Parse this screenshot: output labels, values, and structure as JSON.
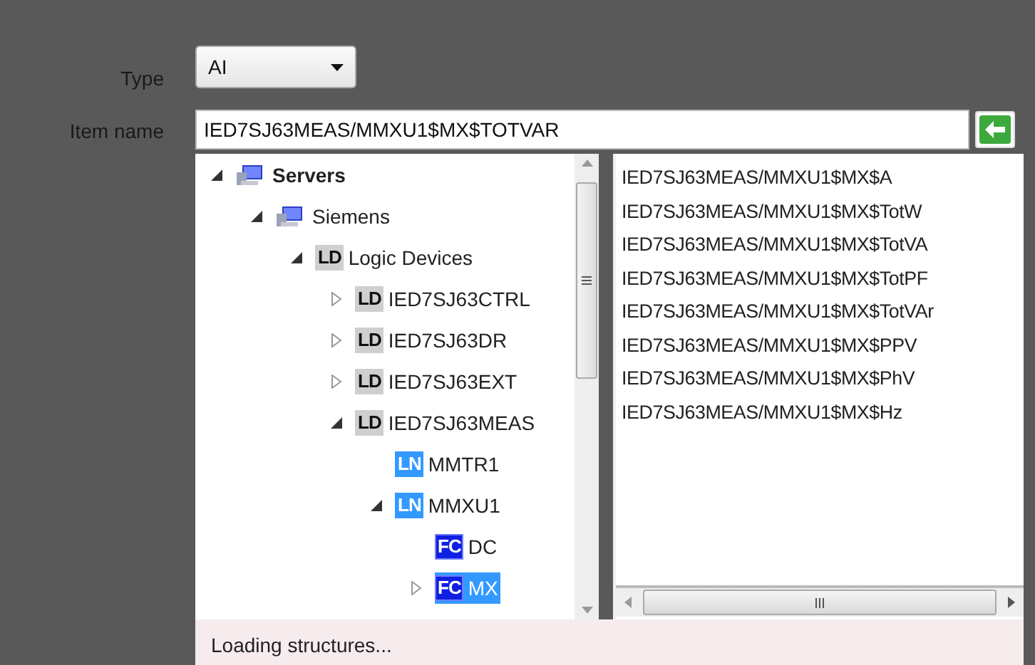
{
  "type_field": {
    "label": "Type",
    "value": "AI"
  },
  "item_name": {
    "label": "Item name",
    "value": "IED7SJ63MEAS/MMXU1$MX$TOTVAR"
  },
  "tree": [
    {
      "label": "Servers",
      "kind": "computer",
      "bold": true,
      "expanded": true,
      "selected": false,
      "children": [
        {
          "label": "Siemens",
          "kind": "computer",
          "bold": false,
          "expanded": true,
          "selected": false,
          "children": [
            {
              "label": "Logic Devices",
              "kind": "ld",
              "badge": "LD",
              "bold": false,
              "expanded": true,
              "selected": false,
              "children": [
                {
                  "label": "IED7SJ63CTRL",
                  "kind": "ld",
                  "badge": "LD",
                  "bold": false,
                  "expanded": false,
                  "selected": false
                },
                {
                  "label": "IED7SJ63DR",
                  "kind": "ld",
                  "badge": "LD",
                  "bold": false,
                  "expanded": false,
                  "selected": false
                },
                {
                  "label": "IED7SJ63EXT",
                  "kind": "ld",
                  "badge": "LD",
                  "bold": false,
                  "expanded": false,
                  "selected": false
                },
                {
                  "label": "IED7SJ63MEAS",
                  "kind": "ld",
                  "badge": "LD",
                  "bold": false,
                  "expanded": true,
                  "selected": false,
                  "children": [
                    {
                      "label": "MMTR1",
                      "kind": "ln",
                      "badge": "LN",
                      "bold": false,
                      "selected": false
                    },
                    {
                      "label": "MMXU1",
                      "kind": "ln",
                      "badge": "LN",
                      "bold": false,
                      "expanded": true,
                      "selected": false,
                      "children": [
                        {
                          "label": "DC",
                          "kind": "fc",
                          "badge": "FC",
                          "bold": false,
                          "selected": false
                        },
                        {
                          "label": "MX",
                          "kind": "fc",
                          "badge": "FC",
                          "bold": false,
                          "expanded": false,
                          "selected": true
                        }
                      ]
                    }
                  ]
                }
              ]
            }
          ]
        }
      ]
    }
  ],
  "items": [
    {
      "label": "IED7SJ63MEAS/MMXU1$MX$A"
    },
    {
      "label": "IED7SJ63MEAS/MMXU1$MX$TotW"
    },
    {
      "label": "IED7SJ63MEAS/MMXU1$MX$TotVA"
    },
    {
      "label": "IED7SJ63MEAS/MMXU1$MX$TotPF"
    },
    {
      "label": "IED7SJ63MEAS/MMXU1$MX$TotVAr"
    },
    {
      "label": "IED7SJ63MEAS/MMXU1$MX$PPV"
    },
    {
      "label": "IED7SJ63MEAS/MMXU1$MX$PhV"
    },
    {
      "label": "IED7SJ63MEAS/MMXU1$MX$Hz"
    }
  ],
  "status": "Loading structures..."
}
